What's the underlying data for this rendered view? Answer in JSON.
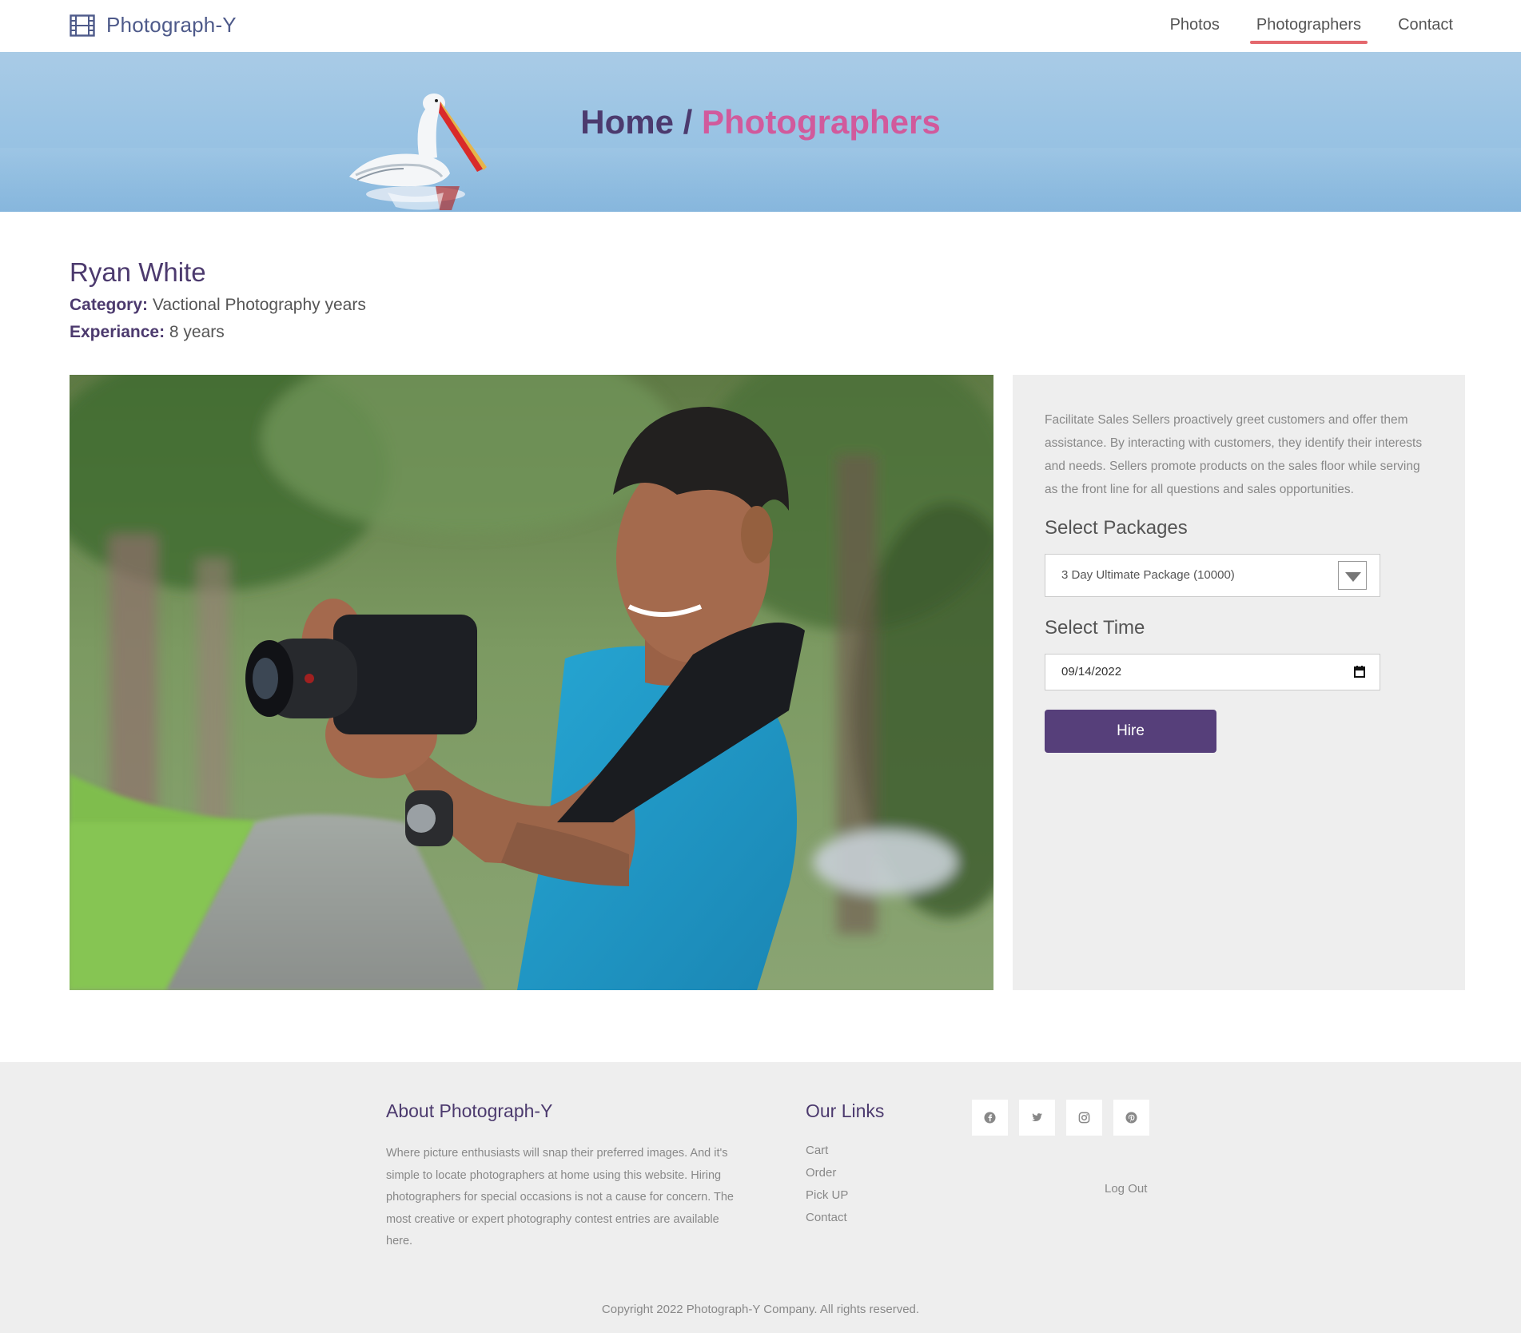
{
  "navbar": {
    "brand": "Photograph-Y",
    "brand_icon": "film-icon",
    "links": [
      {
        "label": "Photos",
        "active": false
      },
      {
        "label": "Photographers",
        "active": true
      },
      {
        "label": "Contact",
        "active": false
      }
    ],
    "active_underline_color": "#e4686d"
  },
  "hero": {
    "home": "Home",
    "separator": "/",
    "current": "Photographers",
    "home_color": "#4c3a6e",
    "current_color": "#d15a9c"
  },
  "profile": {
    "name": "Ryan White",
    "category_label": "Category:",
    "category_value": "Vactional Photography years",
    "experience_label": "Experiance:",
    "experience_value": "8 years"
  },
  "panel": {
    "description": "Facilitate Sales Sellers proactively greet customers and offer them assistance. By interacting with customers, they identify their interests and needs. Sellers promote products on the sales floor while serving as the front line for all questions and sales opportunities.",
    "packages_label": "Select Packages",
    "package_selected": "3 Day Ultimate Package (10000)",
    "time_label": "Select Time",
    "date_value": "09/14/2022",
    "hire_label": "Hire",
    "hire_color": "#563f7a"
  },
  "footer": {
    "about_title": "About Photograph-Y",
    "about_text": "Where picture enthusiasts will snap their preferred images. And it's simple to locate photographers at home using this website. Hiring photographers for special occasions is not a cause for concern. The most creative or expert photography contest entries are available here.",
    "links_title": "Our Links",
    "links": [
      "Cart",
      "Order",
      "Pick UP",
      "Contact"
    ],
    "socials": [
      "facebook-icon",
      "twitter-icon",
      "instagram-icon",
      "pinterest-icon"
    ],
    "logout": "Log Out",
    "copyright": "Copyright 2022 Photograph-Y Company. All rights reserved."
  }
}
